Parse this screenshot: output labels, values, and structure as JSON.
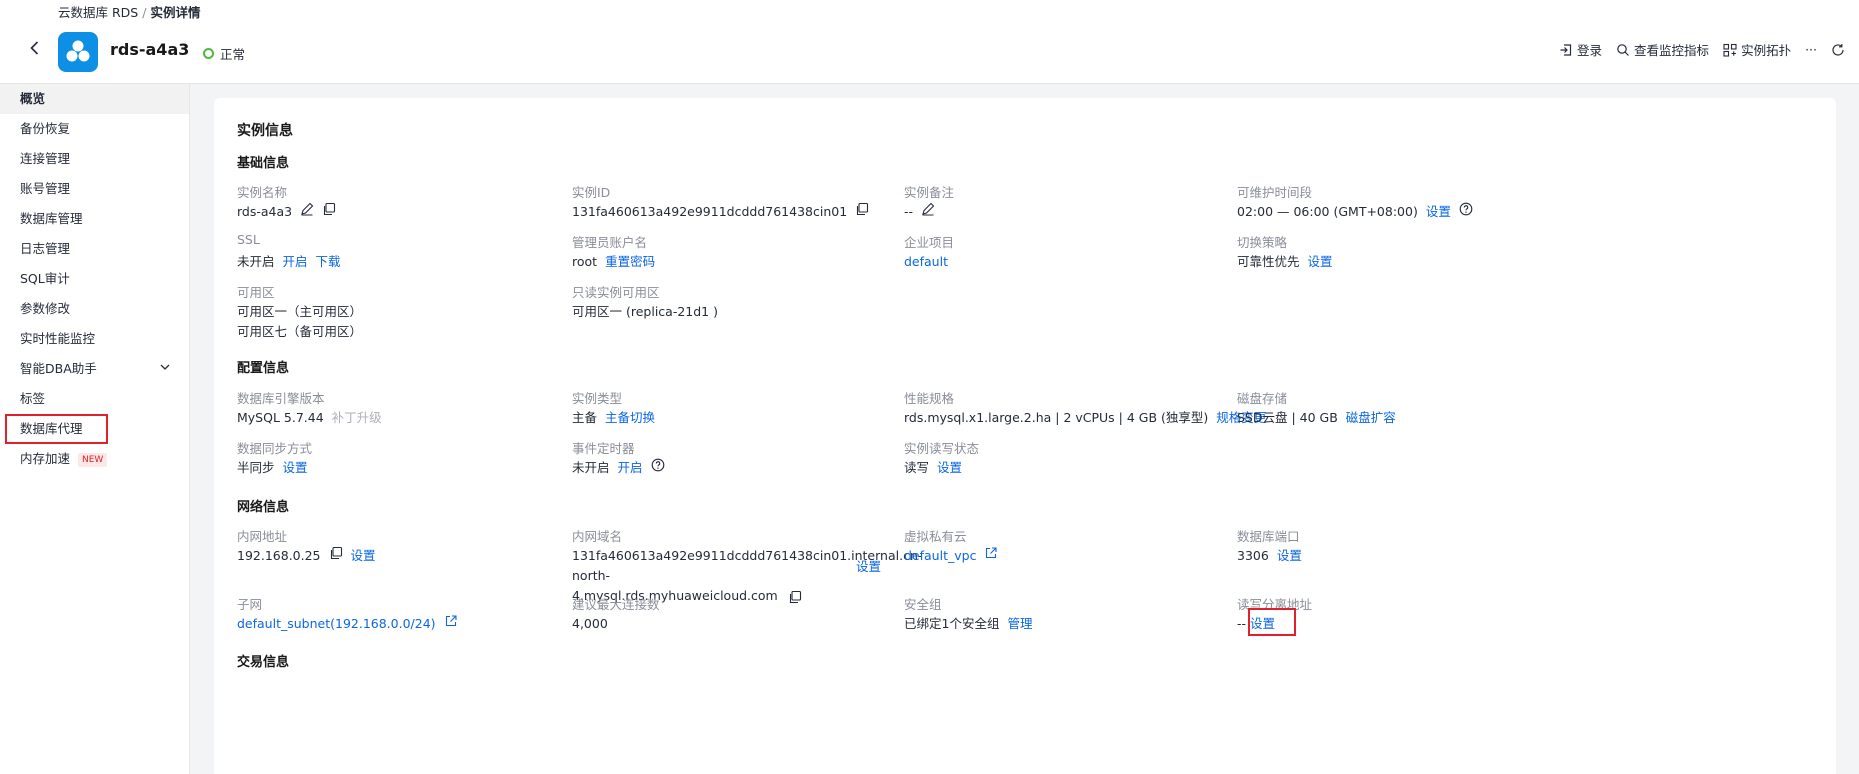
{
  "breadcrumb": {
    "parent": "云数据库 RDS",
    "separator": "/",
    "current": "实例详情"
  },
  "header": {
    "title": "rds-a4a3",
    "status": "正常",
    "actions": {
      "login": "登录",
      "monitor": "查看监控指标",
      "topology": "实例拓扑",
      "more": "···"
    }
  },
  "sidebar": {
    "items": [
      {
        "label": "概览"
      },
      {
        "label": "备份恢复"
      },
      {
        "label": "连接管理"
      },
      {
        "label": "账号管理"
      },
      {
        "label": "数据库管理"
      },
      {
        "label": "日志管理"
      },
      {
        "label": "SQL审计"
      },
      {
        "label": "参数修改"
      },
      {
        "label": "实时性能监控"
      },
      {
        "label": "智能DBA助手"
      },
      {
        "label": "标签"
      },
      {
        "label": "数据库代理"
      },
      {
        "label": "内存加速",
        "badge": "NEW"
      }
    ]
  },
  "main": {
    "card_title": "实例信息",
    "basic": {
      "title": "基础信息",
      "name": {
        "label": "实例名称",
        "value": "rds-a4a3"
      },
      "id": {
        "label": "实例ID",
        "value": "131fa460613a492e9911dcddd761438cin01"
      },
      "remark": {
        "label": "实例备注",
        "value": "--"
      },
      "maintenance": {
        "label": "可维护时间段",
        "value": "02:00 — 06:00 (GMT+08:00)",
        "link": "设置"
      },
      "ssl": {
        "label": "SSL",
        "value": "未开启",
        "link1": "开启",
        "link2": "下载"
      },
      "admin": {
        "label": "管理员账户名",
        "value": "root",
        "link": "重置密码"
      },
      "project": {
        "label": "企业项目",
        "value": "default"
      },
      "switch": {
        "label": "切换策略",
        "value": "可靠性优先",
        "link": "设置"
      },
      "az": {
        "label": "可用区",
        "line1": "可用区一（主可用区）",
        "line2": "可用区七（备可用区）"
      },
      "ro_az": {
        "label": "只读实例可用区",
        "value": "可用区一 (replica-21d1 )"
      }
    },
    "config": {
      "title": "配置信息",
      "engine": {
        "label": "数据库引擎版本",
        "value": "MySQL 5.7.44",
        "muted": "补丁升级"
      },
      "type": {
        "label": "实例类型",
        "value": "主备",
        "link": "主备切换"
      },
      "flavor": {
        "label": "性能规格",
        "value": "rds.mysql.x1.large.2.ha | 2 vCPUs | 4 GB (独享型)",
        "link": "规格变更"
      },
      "storage": {
        "label": "磁盘存储",
        "value": "SSD云盘 | 40 GB",
        "link": "磁盘扩容"
      },
      "sync": {
        "label": "数据同步方式",
        "value": "半同步",
        "link": "设置"
      },
      "event": {
        "label": "事件定时器",
        "value": "未开启",
        "link": "开启"
      },
      "rw": {
        "label": "实例读写状态",
        "value": "读写",
        "link": "设置"
      }
    },
    "network": {
      "title": "网络信息",
      "ip": {
        "label": "内网地址",
        "value": "192.168.0.25",
        "link": "设置"
      },
      "domain": {
        "label": "内网域名",
        "line1": "131fa460613a492e9911dcddd761438cin01.internal.cn-north-",
        "line2": "4.mysql.rds.myhuaweicloud.com",
        "link": "设置"
      },
      "vpc": {
        "label": "虚拟私有云",
        "value": "default_vpc"
      },
      "port": {
        "label": "数据库端口",
        "value": "3306",
        "link": "设置"
      },
      "subnet": {
        "label": "子网",
        "value": "default_subnet(192.168.0.0/24)"
      },
      "maxconn": {
        "label": "建议最大连接数",
        "value": "4,000"
      },
      "secgroup": {
        "label": "安全组",
        "value": "已绑定1个安全组",
        "link": "管理"
      },
      "rwsplit": {
        "label": "读写分离地址",
        "value": "--",
        "link": "设置"
      }
    },
    "trade": {
      "title": "交易信息"
    }
  },
  "colors": {
    "accent": "#0a66e4",
    "status_ok": "#50b83c",
    "highlight": "#e0202a",
    "logo_bg": "#0e8fe6"
  }
}
